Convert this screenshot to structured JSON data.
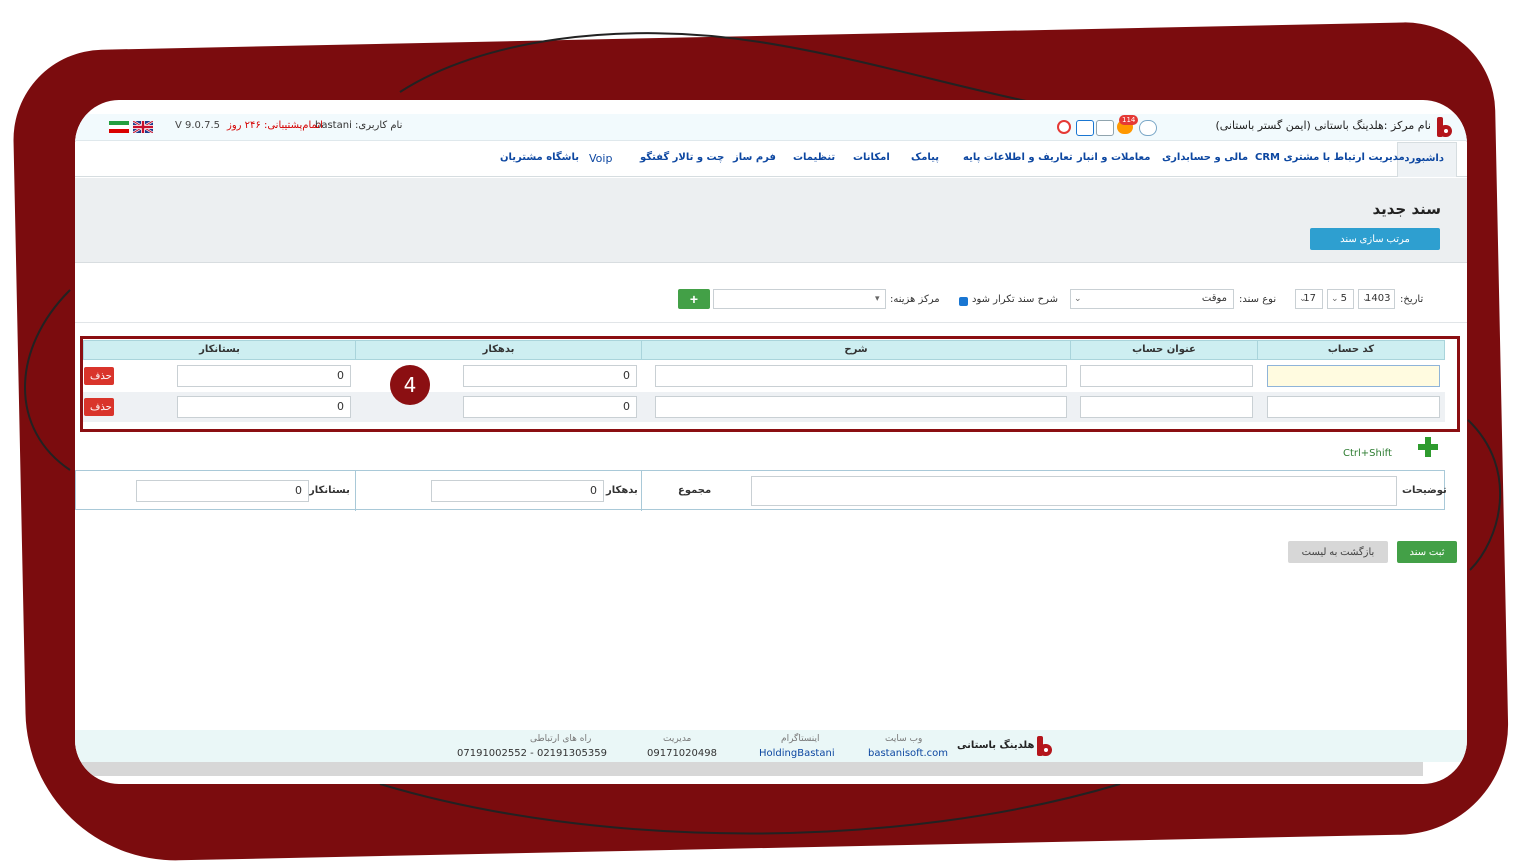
{
  "topbar": {
    "center_name": "نام مرکز :هلدینگ باستانی (ایمن گستر باستانی)",
    "notification_count": "114",
    "username_label": "نام کاربری: bastani",
    "support_label": "اتمام‌پشتیبانی: ۲۴۶ روز",
    "version": "V 9.0.7.5"
  },
  "nav": {
    "items": [
      "داشبورد",
      "مدیریت ارتباط با مشتری CRM",
      "مالی و حسابداری",
      "معاملات و انبار",
      "تعاریف و اطلاعات پایه",
      "پیامک",
      "امکانات",
      "تنظیمات",
      "فرم ساز",
      "چت و تالار گفتگو",
      "Voip",
      "باشگاه مشتریان"
    ]
  },
  "header": {
    "title": "سند جدید",
    "sort_button": "مرتب سازی سند"
  },
  "filters": {
    "date_label": "تاریخ:",
    "year": "1403",
    "month": "5",
    "day": "17",
    "doc_type_label": "نوع سند:",
    "doc_type_value": "موقت",
    "repeat_desc_label": "شرح سند تکرار شود",
    "cost_center_label": "مرکز هزینه:",
    "add_button": "+"
  },
  "table": {
    "columns": [
      "کد حساب",
      "عنوان حساب",
      "شرح",
      "بدهکار",
      "بستانکار"
    ],
    "rows": [
      {
        "account_code": "",
        "account_title": "",
        "description": "",
        "debit": "0",
        "credit": "0",
        "delete": "حذف"
      },
      {
        "account_code": "",
        "account_title": "",
        "description": "",
        "debit": "0",
        "credit": "0",
        "delete": "حذف"
      }
    ],
    "step_number": "4"
  },
  "add_row": {
    "shortcut": "Ctrl+Shift"
  },
  "totals": {
    "notes_label": "توضیحات",
    "notes_value": "",
    "sum_label": "مجموع",
    "debit_label": "بدهکار",
    "debit_value": "0",
    "credit_label": "بستانکار",
    "credit_value": "0"
  },
  "actions": {
    "save": "ثبت سند",
    "back": "بازگشت به لیست"
  },
  "footer": {
    "brand": "هلدینگ باستانی",
    "website_caption": "وب سایت",
    "website_value": "bastanisoft.com",
    "instagram_caption": "اینستاگرام",
    "instagram_value": "HoldingBastani",
    "management_caption": "مدیریت",
    "management_value": "09171020498",
    "contact_caption": "راه های ارتباطی",
    "contact_value": "07191002552 - 02191305359"
  },
  "colors": {
    "frame": "#7b0c0e",
    "accent_blue": "#2e9fd0",
    "green": "#43a047",
    "delete_red": "#d9342b",
    "table_header": "#cdeef1"
  }
}
